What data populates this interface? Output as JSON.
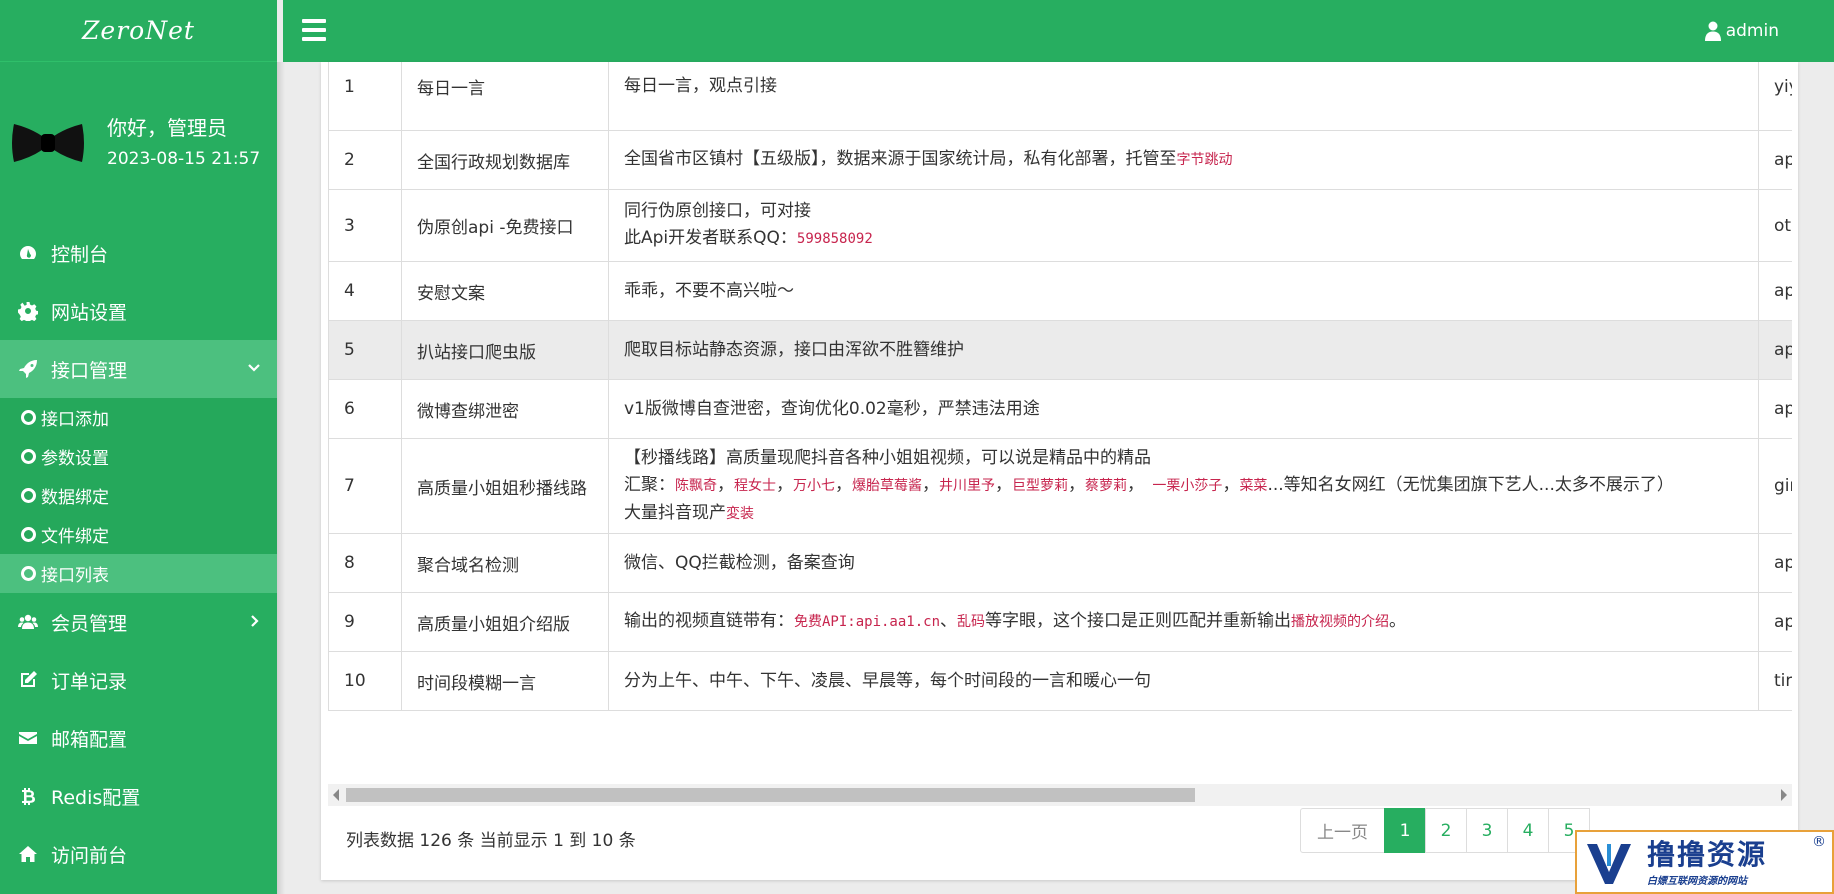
{
  "brand": "ZeroNet",
  "user": {
    "greeting": "你好，管理员",
    "datetime": "2023-08-15 21:57"
  },
  "menu": {
    "dashboard": "控制台",
    "site_settings": "网站设置",
    "api_management": "接口管理",
    "sub": [
      "接口添加",
      "参数设置",
      "数据绑定",
      "文件绑定",
      "接口列表"
    ],
    "members": "会员管理",
    "orders": "订单记录",
    "mail": "邮箱配置",
    "redis": "Redis配置",
    "frontend": "访问前台"
  },
  "topbar": {
    "user": "admin"
  },
  "table": {
    "rows": [
      {
        "id": "1",
        "name": "每日一言",
        "desc": [
          "每日一言，观点引接"
        ],
        "key": "yiy"
      },
      {
        "id": "2",
        "name": "全国行政规划数据库",
        "desc": [
          "全国省市区镇村【五级版】，数据来源于国家统计局，私有化部署，托管至"
        ],
        "code": "字节跳动",
        "key": "api"
      },
      {
        "id": "3",
        "name": "伪原创api -免费接口",
        "desc": [
          "同行伪原创接口，可对接"
        ],
        "desc2_prefix": "此Api开发者联系QQ：",
        "code": "599858092",
        "key": "oth"
      },
      {
        "id": "4",
        "name": "安慰文案",
        "desc": [
          "乖乖，不要不高兴啦～"
        ],
        "key": "api"
      },
      {
        "id": "5",
        "name": "扒站接口爬虫版",
        "desc": [
          "爬取目标站静态资源，接口由浑欲不胜簪维护"
        ],
        "key": "api"
      },
      {
        "id": "6",
        "name": "微博查绑泄密",
        "desc": [
          "v1版微博自查泄密，查询优化0.02毫秒，严禁违法用途"
        ],
        "key": "api"
      },
      {
        "id": "7",
        "name": "高质量小姐姐秒播线路",
        "desc": [
          "【秒播线路】高质量现爬抖音各种小姐姐视频，可以说是精品中的精品"
        ],
        "key": "girl"
      },
      {
        "id": "8",
        "name": "聚合域名检测",
        "desc": [
          "微信、QQ拦截检测，备案查询"
        ],
        "key": "api"
      },
      {
        "id": "9",
        "name": "高质量小姐姐介绍版",
        "key": "api"
      },
      {
        "id": "10",
        "name": "时间段模糊一言",
        "desc": [
          "分为上午、中午、下午、凌晨、早晨等，每个时间段的一言和暖心一句"
        ],
        "key": "tim"
      }
    ],
    "row7_line2_prefix": "汇聚：",
    "row7_names": [
      "陈飘奇",
      "程女士",
      "万小七",
      "爆胎草莓酱",
      "井川里予",
      "巨型萝莉",
      "蔡萝莉",
      " 一栗小莎子",
      "菜菜"
    ],
    "row7_line2_suffix": "...等知名女网红（无忧集团旗下艺人...太多不展示了）",
    "row7_line3_prefix": "大量抖音现产",
    "row7_line3_code": "変装",
    "row9_prefix": "输出的视频直链带有：",
    "row9_code1": "免费API:api.aa1.cn",
    "row9_sep": "、",
    "row9_code2": "乱码",
    "row9_middle": "等字眼，这个接口是正则匹配并重新输出",
    "row9_code3": "播放视频的介绍",
    "row9_end": "。"
  },
  "footer": {
    "info": "列表数据 126 条 当前显示 1 到 10 条"
  },
  "pagination": {
    "prev": "上一页",
    "pages": [
      "1",
      "2",
      "3",
      "4",
      "5"
    ],
    "current": "1"
  },
  "watermark": {
    "title": "撸撸资源",
    "subtitle": "白嫖互联网资源的网站",
    "reg": "®"
  }
}
